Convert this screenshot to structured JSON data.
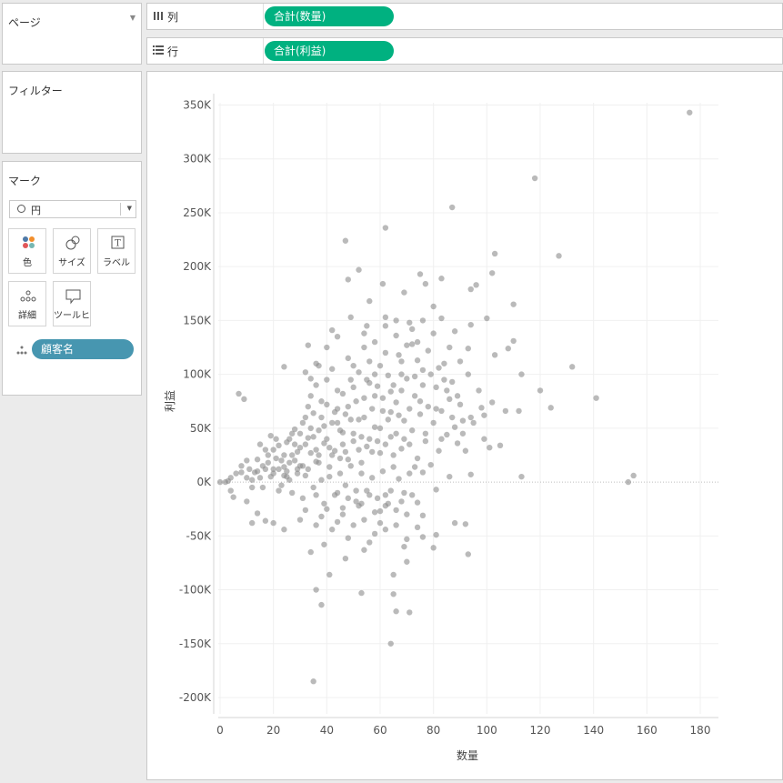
{
  "pages_panel": {
    "title": "ページ"
  },
  "filter_panel": {
    "title": "フィルター"
  },
  "marks_panel": {
    "title": "マーク",
    "mark_type": "円",
    "buttons": [
      {
        "label": "色",
        "icon": "color-icon"
      },
      {
        "label": "サイズ",
        "icon": "size-icon"
      },
      {
        "label": "ラベル",
        "icon": "label-icon"
      },
      {
        "label": "詳細",
        "icon": "detail-icon"
      },
      {
        "label": "ツールヒ…",
        "icon": "tooltip-icon"
      }
    ],
    "detail_field": "顧客名"
  },
  "shelves": {
    "columns": {
      "label": "列",
      "pill": "合計(数量)"
    },
    "rows": {
      "label": "行",
      "pill": "合計(利益)"
    }
  },
  "colors": {
    "measure_pill": "#00b180",
    "dimension_pill": "#4796b0",
    "mark": "#8c8c8c"
  },
  "chart_data": {
    "type": "scatter",
    "xlabel": "数量",
    "ylabel": "利益",
    "xlim": [
      0,
      180
    ],
    "ylim": [
      -200000,
      350000
    ],
    "x_ticks": [
      0,
      20,
      40,
      60,
      80,
      100,
      120,
      140,
      160,
      180
    ],
    "y_ticks": [
      -200000,
      -150000,
      -100000,
      -50000,
      0,
      50000,
      100000,
      150000,
      200000,
      250000,
      300000,
      350000
    ],
    "x_tick_labels": [
      "0",
      "20",
      "40",
      "60",
      "80",
      "100",
      "120",
      "140",
      "160",
      "180"
    ],
    "y_tick_labels": [
      "-200K",
      "-150K",
      "-100K",
      "-50K",
      "0K",
      "50K",
      "100K",
      "150K",
      "200K",
      "250K",
      "300K",
      "350K"
    ],
    "grid": true,
    "points": [
      [
        176,
        343000
      ],
      [
        118,
        282000
      ],
      [
        127,
        210000
      ],
      [
        87,
        255000
      ],
      [
        62,
        236000
      ],
      [
        47,
        224000
      ],
      [
        103,
        212000
      ],
      [
        102,
        194000
      ],
      [
        75,
        193000
      ],
      [
        52,
        197000
      ],
      [
        56,
        168000
      ],
      [
        77,
        184000
      ],
      [
        83,
        189000
      ],
      [
        61,
        184000
      ],
      [
        48,
        188000
      ],
      [
        69,
        176000
      ],
      [
        94,
        179000
      ],
      [
        96,
        183000
      ],
      [
        80,
        163000
      ],
      [
        110,
        165000
      ],
      [
        94,
        146000
      ],
      [
        100,
        152000
      ],
      [
        83,
        152000
      ],
      [
        66,
        150000
      ],
      [
        62,
        153000
      ],
      [
        71,
        148000
      ],
      [
        49,
        153000
      ],
      [
        42,
        141000
      ],
      [
        55,
        145000
      ],
      [
        74,
        130000
      ],
      [
        103,
        118000
      ],
      [
        108,
        124000
      ],
      [
        110,
        131000
      ],
      [
        93,
        124000
      ],
      [
        132,
        107000
      ],
      [
        113,
        100000
      ],
      [
        141,
        78000
      ],
      [
        120,
        85000
      ],
      [
        124,
        69000
      ],
      [
        98,
        69000
      ],
      [
        102,
        74000
      ],
      [
        94,
        60000
      ],
      [
        99,
        62000
      ],
      [
        107,
        66000
      ],
      [
        112,
        66000
      ],
      [
        101,
        32000
      ],
      [
        105,
        34000
      ],
      [
        113,
        5000
      ],
      [
        94,
        7000
      ],
      [
        153,
        0
      ],
      [
        155,
        6000
      ],
      [
        86,
        5000
      ],
      [
        76,
        9000
      ],
      [
        7,
        82000
      ],
      [
        9,
        77000
      ],
      [
        24,
        107000
      ],
      [
        33,
        127000
      ],
      [
        32,
        102000
      ],
      [
        37,
        108000
      ],
      [
        34,
        96000
      ],
      [
        88,
        -38000
      ],
      [
        92,
        -39000
      ],
      [
        93,
        -67000
      ],
      [
        81,
        -49000
      ],
      [
        76,
        -51000
      ],
      [
        80,
        -61000
      ],
      [
        69,
        -60000
      ],
      [
        70,
        -74000
      ],
      [
        65,
        -86000
      ],
      [
        65,
        -104000
      ],
      [
        66,
        -120000
      ],
      [
        71,
        -121000
      ],
      [
        64,
        -150000
      ],
      [
        35,
        -185000
      ],
      [
        36,
        -100000
      ],
      [
        38,
        -114000
      ],
      [
        41,
        -86000
      ],
      [
        53,
        -103000
      ],
      [
        47,
        -71000
      ],
      [
        54,
        -63000
      ],
      [
        34,
        -65000
      ],
      [
        39,
        -58000
      ],
      [
        12,
        -38000
      ],
      [
        17,
        -36000
      ],
      [
        20,
        -38000
      ],
      [
        10,
        -18000
      ],
      [
        4,
        -8000
      ],
      [
        5,
        -14000
      ],
      [
        14,
        -29000
      ],
      [
        24,
        -44000
      ],
      [
        44,
        -37000
      ],
      [
        36,
        -40000
      ],
      [
        58,
        -48000
      ],
      [
        62,
        -44000
      ],
      [
        70,
        -53000
      ],
      [
        56,
        -56000
      ],
      [
        48,
        -52000
      ],
      [
        30,
        -35000
      ],
      [
        32,
        -26000
      ],
      [
        46,
        -24000
      ],
      [
        53,
        -20000
      ],
      [
        60,
        -27000
      ],
      [
        66,
        -26000
      ],
      [
        74,
        -19000
      ],
      [
        76,
        -31000
      ],
      [
        81,
        -7000
      ],
      [
        0,
        0
      ],
      [
        2,
        0
      ],
      [
        3,
        1000
      ],
      [
        4,
        4000
      ],
      [
        6,
        8000
      ],
      [
        8,
        9000
      ],
      [
        10,
        4000
      ],
      [
        11,
        12000
      ],
      [
        12,
        -5000
      ],
      [
        13,
        9000
      ],
      [
        14,
        21000
      ],
      [
        15,
        4000
      ],
      [
        16,
        15000
      ],
      [
        17,
        30000
      ],
      [
        18,
        18000
      ],
      [
        19,
        43000
      ],
      [
        20,
        8000
      ],
      [
        21,
        22000
      ],
      [
        22,
        34000
      ],
      [
        23,
        -3000
      ],
      [
        24,
        14000
      ],
      [
        25,
        37000
      ],
      [
        26,
        2000
      ],
      [
        27,
        25000
      ],
      [
        28,
        49000
      ],
      [
        29,
        12000
      ],
      [
        30,
        32000
      ],
      [
        31,
        55000
      ],
      [
        32,
        6000
      ],
      [
        33,
        41000
      ],
      [
        34,
        27000
      ],
      [
        35,
        64000
      ],
      [
        36,
        19000
      ],
      [
        37,
        48000
      ],
      [
        38,
        2000
      ],
      [
        39,
        36000
      ],
      [
        40,
        72000
      ],
      [
        41,
        14000
      ],
      [
        42,
        55000
      ],
      [
        43,
        29000
      ],
      [
        44,
        85000
      ],
      [
        45,
        8000
      ],
      [
        46,
        46000
      ],
      [
        47,
        63000
      ],
      [
        48,
        21000
      ],
      [
        49,
        95000
      ],
      [
        50,
        38000
      ],
      [
        51,
        -8000
      ],
      [
        52,
        58000
      ],
      [
        53,
        18000
      ],
      [
        54,
        78000
      ],
      [
        55,
        33000
      ],
      [
        56,
        112000
      ],
      [
        57,
        4000
      ],
      [
        58,
        51000
      ],
      [
        59,
        89000
      ],
      [
        60,
        27000
      ],
      [
        61,
        66000
      ],
      [
        62,
        -12000
      ],
      [
        63,
        99000
      ],
      [
        64,
        42000
      ],
      [
        65,
        14000
      ],
      [
        66,
        74000
      ],
      [
        67,
        118000
      ],
      [
        68,
        31000
      ],
      [
        69,
        57000
      ],
      [
        70,
        96000
      ],
      [
        71,
        8000
      ],
      [
        72,
        48000
      ],
      [
        73,
        80000
      ],
      [
        74,
        22000
      ],
      [
        75,
        63000
      ],
      [
        76,
        104000
      ],
      [
        77,
        38000
      ],
      [
        78,
        70000
      ],
      [
        79,
        16000
      ],
      [
        80,
        55000
      ],
      [
        81,
        88000
      ],
      [
        82,
        29000
      ],
      [
        83,
        66000
      ],
      [
        84,
        110000
      ],
      [
        85,
        44000
      ],
      [
        86,
        77000
      ],
      [
        87,
        93000
      ],
      [
        88,
        51000
      ],
      [
        89,
        36000
      ],
      [
        90,
        72000
      ],
      [
        91,
        57000
      ],
      [
        92,
        29000
      ],
      [
        20,
        30000
      ],
      [
        22,
        12000
      ],
      [
        24,
        25000
      ],
      [
        26,
        40000
      ],
      [
        28,
        20000
      ],
      [
        30,
        45000
      ],
      [
        32,
        35000
      ],
      [
        34,
        50000
      ],
      [
        36,
        30000
      ],
      [
        38,
        60000
      ],
      [
        40,
        40000
      ],
      [
        42,
        25000
      ],
      [
        44,
        55000
      ],
      [
        46,
        35000
      ],
      [
        48,
        70000
      ],
      [
        50,
        45000
      ],
      [
        52,
        30000
      ],
      [
        54,
        60000
      ],
      [
        56,
        40000
      ],
      [
        58,
        80000
      ],
      [
        60,
        50000
      ],
      [
        62,
        35000
      ],
      [
        64,
        65000
      ],
      [
        66,
        45000
      ],
      [
        68,
        85000
      ],
      [
        25,
        5000
      ],
      [
        27,
        -10000
      ],
      [
        29,
        8000
      ],
      [
        31,
        -15000
      ],
      [
        33,
        12000
      ],
      [
        35,
        -5000
      ],
      [
        37,
        18000
      ],
      [
        39,
        -20000
      ],
      [
        41,
        5000
      ],
      [
        43,
        -12000
      ],
      [
        45,
        22000
      ],
      [
        47,
        -3000
      ],
      [
        49,
        15000
      ],
      [
        51,
        -18000
      ],
      [
        53,
        8000
      ],
      [
        55,
        -8000
      ],
      [
        57,
        28000
      ],
      [
        59,
        -15000
      ],
      [
        61,
        10000
      ],
      [
        63,
        -20000
      ],
      [
        65,
        25000
      ],
      [
        67,
        3000
      ],
      [
        69,
        -10000
      ],
      [
        71,
        35000
      ],
      [
        73,
        14000
      ],
      [
        8,
        15000
      ],
      [
        10,
        20000
      ],
      [
        12,
        2000
      ],
      [
        14,
        10000
      ],
      [
        16,
        -5000
      ],
      [
        18,
        25000
      ],
      [
        20,
        12000
      ],
      [
        22,
        -8000
      ],
      [
        24,
        6000
      ],
      [
        26,
        18000
      ],
      [
        28,
        35000
      ],
      [
        30,
        15000
      ],
      [
        32,
        60000
      ],
      [
        34,
        80000
      ],
      [
        36,
        90000
      ],
      [
        38,
        75000
      ],
      [
        40,
        95000
      ],
      [
        42,
        105000
      ],
      [
        44,
        68000
      ],
      [
        46,
        82000
      ],
      [
        48,
        115000
      ],
      [
        50,
        88000
      ],
      [
        52,
        102000
      ],
      [
        54,
        125000
      ],
      [
        56,
        92000
      ],
      [
        58,
        130000
      ],
      [
        60,
        108000
      ],
      [
        62,
        120000
      ],
      [
        64,
        84000
      ],
      [
        66,
        136000
      ],
      [
        68,
        100000
      ],
      [
        70,
        127000
      ],
      [
        72,
        142000
      ],
      [
        74,
        113000
      ],
      [
        76,
        90000
      ],
      [
        78,
        122000
      ],
      [
        80,
        138000
      ],
      [
        82,
        106000
      ],
      [
        84,
        95000
      ],
      [
        86,
        125000
      ],
      [
        88,
        140000
      ],
      [
        90,
        112000
      ],
      [
        15,
        35000
      ],
      [
        17,
        12000
      ],
      [
        19,
        5000
      ],
      [
        21,
        40000
      ],
      [
        23,
        20000
      ],
      [
        25,
        10000
      ],
      [
        27,
        45000
      ],
      [
        29,
        28000
      ],
      [
        31,
        15000
      ],
      [
        33,
        70000
      ],
      [
        35,
        42000
      ],
      [
        37,
        25000
      ],
      [
        39,
        52000
      ],
      [
        41,
        32000
      ],
      [
        43,
        65000
      ],
      [
        45,
        48000
      ],
      [
        47,
        28000
      ],
      [
        49,
        58000
      ],
      [
        51,
        75000
      ],
      [
        53,
        42000
      ],
      [
        55,
        95000
      ],
      [
        57,
        68000
      ],
      [
        59,
        38000
      ],
      [
        61,
        78000
      ],
      [
        63,
        58000
      ],
      [
        65,
        90000
      ],
      [
        67,
        62000
      ],
      [
        69,
        40000
      ],
      [
        71,
        68000
      ],
      [
        73,
        98000
      ],
      [
        75,
        75000
      ],
      [
        77,
        45000
      ],
      [
        79,
        100000
      ],
      [
        81,
        68000
      ],
      [
        83,
        40000
      ],
      [
        85,
        85000
      ],
      [
        87,
        60000
      ],
      [
        89,
        80000
      ],
      [
        91,
        45000
      ],
      [
        93,
        100000
      ],
      [
        95,
        55000
      ],
      [
        97,
        85000
      ],
      [
        99,
        40000
      ],
      [
        36,
        -12000
      ],
      [
        38,
        -32000
      ],
      [
        40,
        -25000
      ],
      [
        42,
        -44000
      ],
      [
        44,
        -10000
      ],
      [
        46,
        -30000
      ],
      [
        48,
        -15000
      ],
      [
        50,
        -40000
      ],
      [
        52,
        -22000
      ],
      [
        54,
        -35000
      ],
      [
        56,
        -12000
      ],
      [
        58,
        -28000
      ],
      [
        60,
        -38000
      ],
      [
        62,
        -22000
      ],
      [
        64,
        -8000
      ],
      [
        66,
        -40000
      ],
      [
        68,
        -18000
      ],
      [
        70,
        -30000
      ],
      [
        72,
        -12000
      ],
      [
        74,
        -42000
      ],
      [
        36,
        110000
      ],
      [
        40,
        125000
      ],
      [
        44,
        135000
      ],
      [
        50,
        108000
      ],
      [
        54,
        138000
      ],
      [
        58,
        100000
      ],
      [
        62,
        145000
      ],
      [
        68,
        112000
      ],
      [
        72,
        128000
      ],
      [
        76,
        150000
      ]
    ]
  }
}
